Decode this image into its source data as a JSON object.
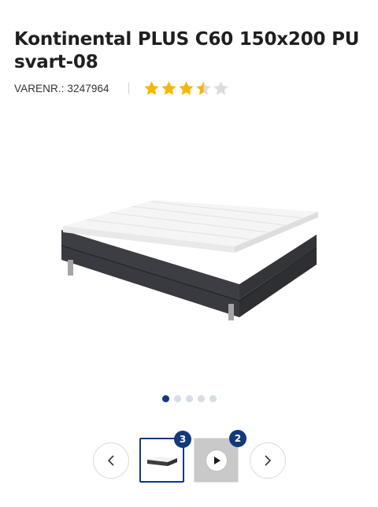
{
  "product": {
    "title": "Kontinental PLUS C60 150x200 PU svart-08",
    "sku_label": "VARENR.: 3247964",
    "rating": 3.5,
    "rating_max": 5,
    "star_color": "#f5b700",
    "star_empty_color": "#dcdcdc"
  },
  "gallery": {
    "main_image_icon": "continental-bed-image",
    "dots_count": 5,
    "active_dot": 0,
    "accent_color": "#123a7a",
    "prev_icon": "chevron-left-icon",
    "next_icon": "chevron-right-icon",
    "thumbnails": [
      {
        "icon": "bed-thumbnail-image",
        "badge": "3"
      },
      {
        "icon": "video-play-icon",
        "badge": "2"
      }
    ]
  }
}
